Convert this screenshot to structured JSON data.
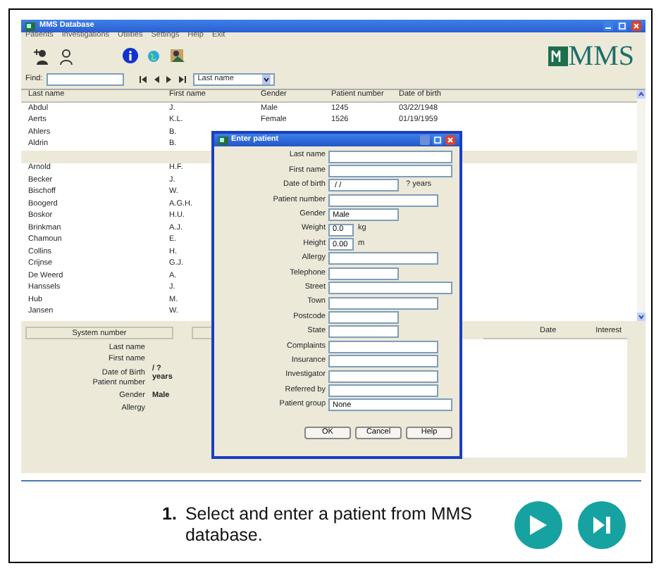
{
  "window": {
    "title": "MMS Database",
    "menu": [
      "Patients",
      "Investigations",
      "Utilities",
      "Settings",
      "Help",
      "Exit"
    ]
  },
  "logo": "MMS",
  "find": {
    "label": "Find:",
    "sort_value": "Last name"
  },
  "table": {
    "columns": [
      "Last name",
      "First name",
      "Gender",
      "Patient number",
      "Date of birth"
    ],
    "rows": [
      {
        "cells": [
          "Abdul",
          "J.",
          "Male",
          "1245",
          "03/22/1948"
        ],
        "selected": false
      },
      {
        "cells": [
          "Aerts",
          "K.L.",
          "Female",
          "1526",
          "01/19/1959"
        ],
        "selected": false
      },
      {
        "cells": [
          "Ahlers",
          "B."
        ],
        "selected": false
      },
      {
        "cells": [
          "Aldrin",
          "B."
        ],
        "selected": false
      },
      {
        "cells": [],
        "selected": true
      },
      {
        "cells": [
          "Arnold",
          "H.F."
        ],
        "selected": false
      },
      {
        "cells": [
          "Becker",
          "J."
        ],
        "selected": false
      },
      {
        "cells": [
          "Bischoff",
          "W."
        ],
        "selected": false
      },
      {
        "cells": [
          "Boogerd",
          "A.G.H."
        ],
        "selected": false
      },
      {
        "cells": [
          "Boskor",
          "H.U."
        ],
        "selected": false
      },
      {
        "cells": [
          "Brinkman",
          "A.J."
        ],
        "selected": false
      },
      {
        "cells": [
          "Chamoun",
          "E."
        ],
        "selected": false
      },
      {
        "cells": [
          "Collins",
          "H."
        ],
        "selected": false
      },
      {
        "cells": [
          "Crijnse",
          "G.J."
        ],
        "selected": false
      },
      {
        "cells": [
          "De Weerd",
          "A."
        ],
        "selected": false
      },
      {
        "cells": [
          "Hanssels",
          "J."
        ],
        "selected": false
      },
      {
        "cells": [
          "Hub",
          "M."
        ],
        "selected": false
      },
      {
        "cells": [
          "Jansen",
          "W."
        ],
        "selected": false
      }
    ]
  },
  "details": {
    "header": "System number",
    "fields": [
      {
        "label": "Last name"
      },
      {
        "label": "First name"
      },
      {
        "label": "Date of Birth",
        "value": "/ ? years"
      },
      {
        "label": "Patient number"
      },
      {
        "label": "Gender",
        "value": "Male"
      },
      {
        "label": "Allergy"
      }
    ],
    "list_columns": [
      "Date",
      "Interest"
    ]
  },
  "dialog": {
    "title": "Enter patient",
    "fields": [
      {
        "label": "Last name",
        "kind": "wide"
      },
      {
        "label": "First name",
        "kind": "wide"
      },
      {
        "label": "Date of birth",
        "kind": "medium",
        "value": " / /",
        "suffix": "? years"
      },
      {
        "label": "Patient number",
        "kind": "long"
      },
      {
        "label": "Gender",
        "kind": "medium",
        "value": "Male"
      },
      {
        "label": "Weight",
        "kind": "tiny",
        "value": "0.0",
        "suffix": "kg"
      },
      {
        "label": "Height",
        "kind": "tiny",
        "value": "0.00",
        "suffix": "m"
      },
      {
        "label": "Allergy",
        "kind": "long"
      },
      {
        "label": "Telephone",
        "kind": "medium"
      },
      {
        "label": "Street",
        "kind": "wide"
      },
      {
        "label": "Town",
        "kind": "long"
      },
      {
        "label": "Postcode",
        "kind": "medium"
      },
      {
        "label": "State",
        "kind": "medium"
      },
      {
        "label": "Complaints",
        "kind": "long"
      },
      {
        "label": "Insurance",
        "kind": "long"
      },
      {
        "label": "Investigator",
        "kind": "long"
      },
      {
        "label": "Referred by",
        "kind": "long"
      },
      {
        "label": "Patient group",
        "kind": "wide",
        "value": "None"
      }
    ],
    "buttons": [
      "OK",
      "Cancel",
      "Help"
    ]
  },
  "caption": {
    "number": "1.",
    "text": "Select and enter a patient from MMS database."
  }
}
